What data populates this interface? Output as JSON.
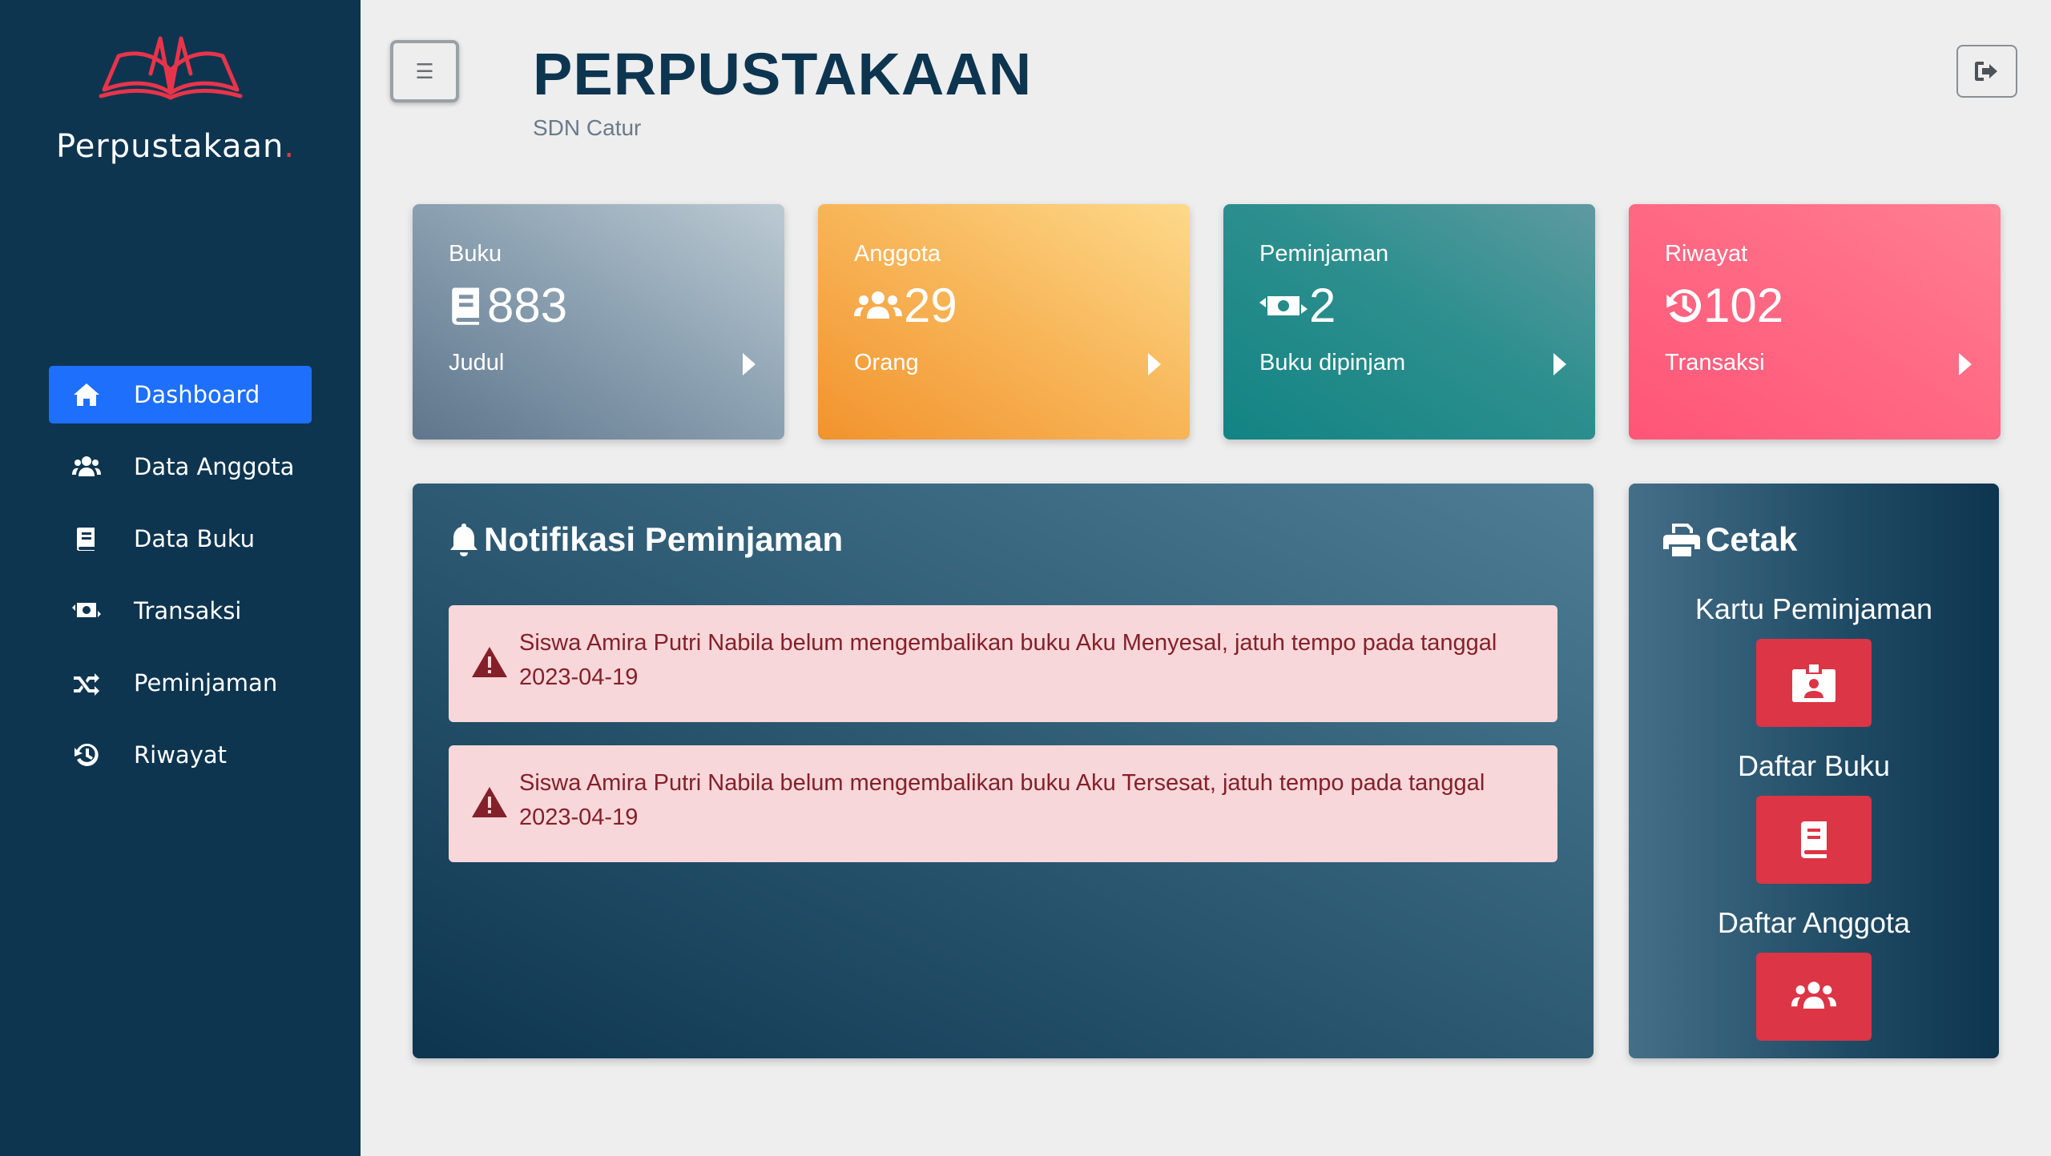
{
  "brand": {
    "name": "Perpustakaan",
    "dot": "."
  },
  "sidebar": {
    "items": [
      {
        "label": "Dashboard",
        "icon": "home-icon",
        "active": true
      },
      {
        "label": "Data Anggota",
        "icon": "users-icon"
      },
      {
        "label": "Data Buku",
        "icon": "book-icon"
      },
      {
        "label": "Transaksi",
        "icon": "money-exchange-icon"
      },
      {
        "label": "Peminjaman",
        "icon": "shuffle-icon"
      },
      {
        "label": "Riwayat",
        "icon": "history-icon"
      }
    ]
  },
  "header": {
    "menu_toggle": "☰",
    "title": "PERPUSTAKAAN",
    "subtitle": "SDN Catur",
    "logout_icon": "logout-icon"
  },
  "cards": [
    {
      "label": "Buku",
      "value": "883",
      "footer": "Judul",
      "icon": "book-icon"
    },
    {
      "label": "Anggota",
      "value": "29",
      "footer": "Orang",
      "icon": "users-icon"
    },
    {
      "label": "Peminjaman",
      "value": "2",
      "footer": "Buku dipinjam",
      "icon": "money-exchange-icon"
    },
    {
      "label": "Riwayat",
      "value": "102",
      "footer": "Transaksi",
      "icon": "history-icon"
    }
  ],
  "notifications": {
    "title": "Notifikasi Peminjaman",
    "icon": "bell-icon",
    "alerts": [
      {
        "message": "Siswa Amira Putri Nabila belum mengembalikan buku Aku Menyesal, jatuh tempo pada tanggal 2023-04-19"
      },
      {
        "message": "Siswa Amira Putri Nabila belum mengembalikan buku Aku Tersesat, jatuh tempo pada tanggal 2023-04-19"
      }
    ]
  },
  "cetak": {
    "title": "Cetak",
    "icon": "print-icon",
    "items": [
      {
        "label": "Kartu Peminjaman",
        "icon": "id-card-icon"
      },
      {
        "label": "Daftar Buku",
        "icon": "book-icon"
      },
      {
        "label": "Daftar Anggota",
        "icon": "users-icon"
      }
    ]
  },
  "colors": {
    "sidebar": "#0d3550",
    "accent": "#1e6ffb",
    "danger": "#dc3545",
    "brand_dot": "#e8344a"
  }
}
